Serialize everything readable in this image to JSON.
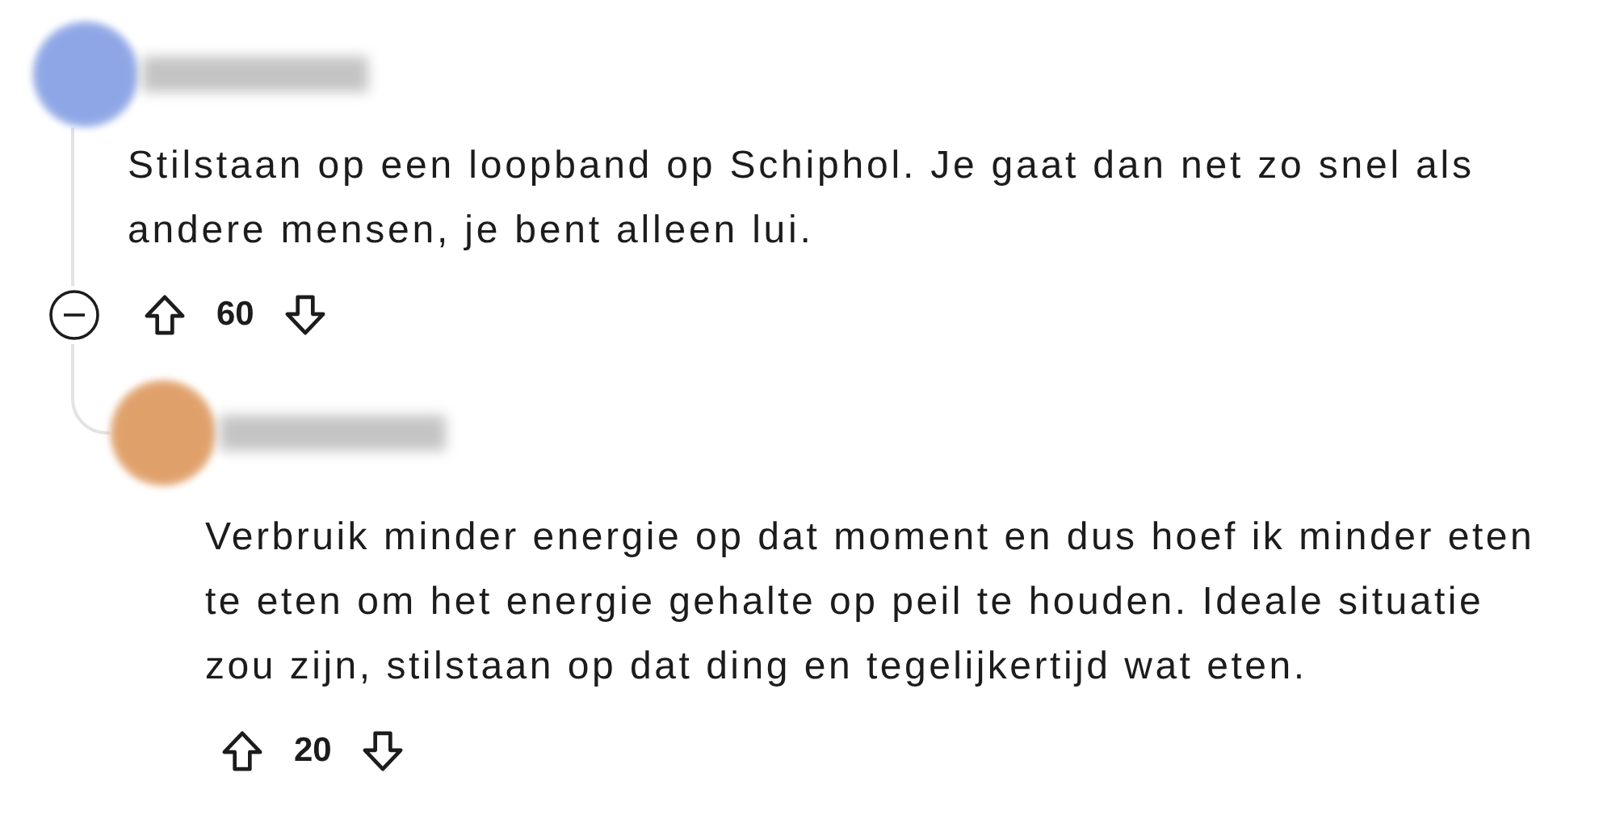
{
  "comments": [
    {
      "color": "#8ea6e6",
      "text": "Stilstaan op een loopband op Schiphol. Je gaat dan net zo snel als andere mensen, je bent alleen lui.",
      "score": "60",
      "expanded": true,
      "children": [
        {
          "color": "#e0a06a",
          "text": "Verbruik minder energie op dat moment en dus hoef ik minder eten te eten om het energie gehalte op peil te houden. Ideale situatie zou zijn, stilstaan op dat ding en tegelijkertijd wat eten.",
          "score": "20"
        }
      ]
    }
  ]
}
